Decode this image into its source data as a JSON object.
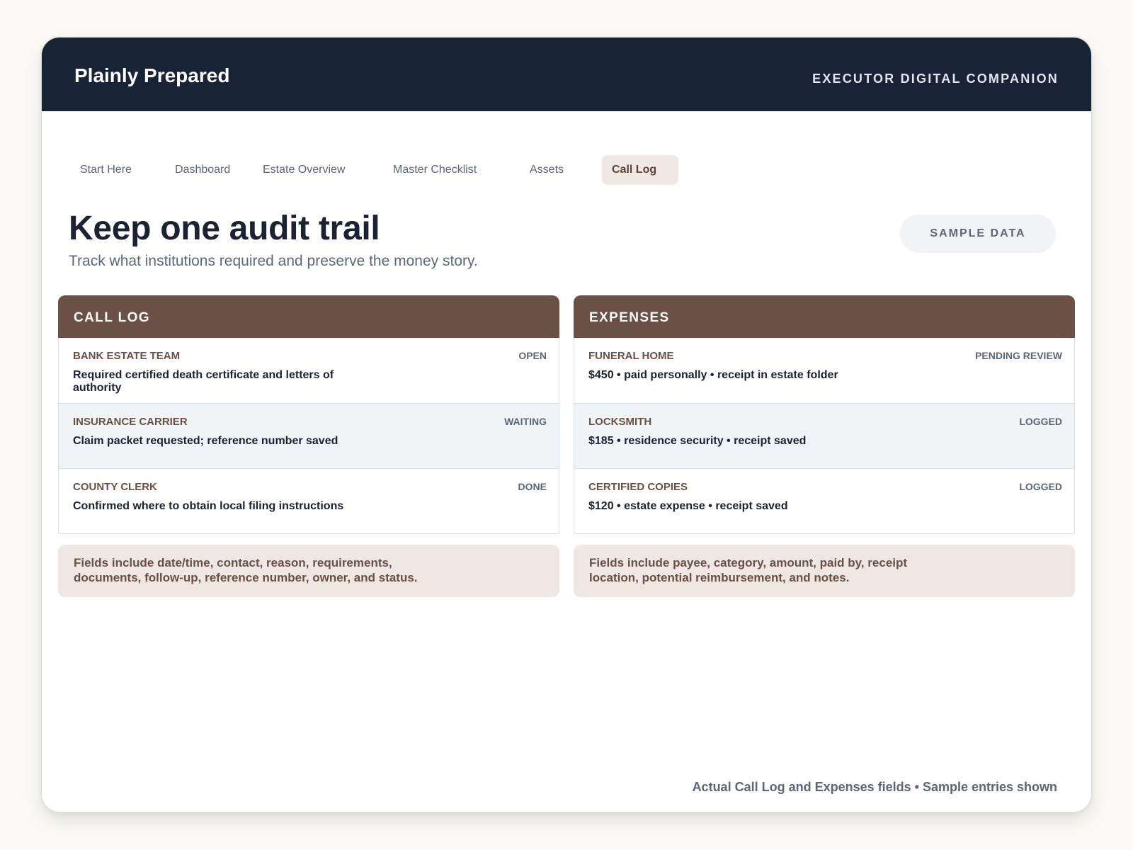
{
  "app": {
    "brand": "Plainly Prepared",
    "tagline": "EXECUTOR DIGITAL COMPANION"
  },
  "nav": {
    "tabs": [
      {
        "label": "Start Here"
      },
      {
        "label": "Dashboard"
      },
      {
        "label": "Estate Overview"
      },
      {
        "label": "Master Checklist"
      },
      {
        "label": "Assets"
      },
      {
        "label": "Call Log"
      }
    ],
    "active": "Call Log"
  },
  "page": {
    "title": "Keep one audit trail",
    "subtitle": "Track what institutions required and preserve the money story.",
    "badge": "SAMPLE DATA"
  },
  "call_log": {
    "header": "CALL LOG",
    "rows": [
      {
        "title": "BANK ESTATE TEAM",
        "status": "OPEN",
        "desc": "Required certified death certificate and letters of authority"
      },
      {
        "title": "INSURANCE CARRIER",
        "status": "WAITING",
        "desc": "Claim packet requested; reference number saved"
      },
      {
        "title": "COUNTY CLERK",
        "status": "DONE",
        "desc": "Confirmed where to obtain local filing instructions"
      }
    ],
    "note": "Fields include date/time, contact, reason, requirements, documents, follow-up, reference number, owner, and status."
  },
  "expenses": {
    "header": "EXPENSES",
    "rows": [
      {
        "title": "FUNERAL HOME",
        "status": "PENDING REVIEW",
        "desc": "$450 • paid personally • receipt in estate folder"
      },
      {
        "title": "LOCKSMITH",
        "status": "LOGGED",
        "desc": "$185 • residence security • receipt saved"
      },
      {
        "title": "CERTIFIED COPIES",
        "status": "LOGGED",
        "desc": "$120 • estate expense • receipt saved"
      }
    ],
    "note": "Fields include payee, category, amount, paid by, receipt location, potential reimbursement, and notes."
  },
  "footer": {
    "note": "Actual Call Log and Expenses fields • Sample entries shown"
  },
  "colors": {
    "topbar": "#182335",
    "panel_header": "#6a5045",
    "active_tab_bg": "#f0e8e5",
    "note_bg": "#efe7e4",
    "alt_row_bg": "#f1f4f7"
  }
}
